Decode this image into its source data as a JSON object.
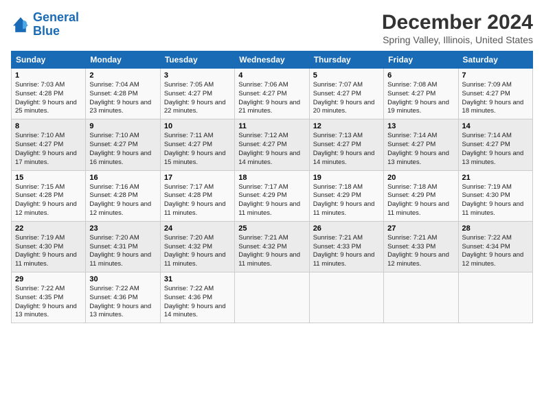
{
  "logo": {
    "line1": "General",
    "line2": "Blue"
  },
  "title": "December 2024",
  "subtitle": "Spring Valley, Illinois, United States",
  "days_header": [
    "Sunday",
    "Monday",
    "Tuesday",
    "Wednesday",
    "Thursday",
    "Friday",
    "Saturday"
  ],
  "weeks": [
    [
      {
        "day": 1,
        "sunrise": "7:03 AM",
        "sunset": "4:28 PM",
        "daylight": "9 hours and 25 minutes."
      },
      {
        "day": 2,
        "sunrise": "7:04 AM",
        "sunset": "4:28 PM",
        "daylight": "9 hours and 23 minutes."
      },
      {
        "day": 3,
        "sunrise": "7:05 AM",
        "sunset": "4:27 PM",
        "daylight": "9 hours and 22 minutes."
      },
      {
        "day": 4,
        "sunrise": "7:06 AM",
        "sunset": "4:27 PM",
        "daylight": "9 hours and 21 minutes."
      },
      {
        "day": 5,
        "sunrise": "7:07 AM",
        "sunset": "4:27 PM",
        "daylight": "9 hours and 20 minutes."
      },
      {
        "day": 6,
        "sunrise": "7:08 AM",
        "sunset": "4:27 PM",
        "daylight": "9 hours and 19 minutes."
      },
      {
        "day": 7,
        "sunrise": "7:09 AM",
        "sunset": "4:27 PM",
        "daylight": "9 hours and 18 minutes."
      }
    ],
    [
      {
        "day": 8,
        "sunrise": "7:10 AM",
        "sunset": "4:27 PM",
        "daylight": "9 hours and 17 minutes."
      },
      {
        "day": 9,
        "sunrise": "7:10 AM",
        "sunset": "4:27 PM",
        "daylight": "9 hours and 16 minutes."
      },
      {
        "day": 10,
        "sunrise": "7:11 AM",
        "sunset": "4:27 PM",
        "daylight": "9 hours and 15 minutes."
      },
      {
        "day": 11,
        "sunrise": "7:12 AM",
        "sunset": "4:27 PM",
        "daylight": "9 hours and 14 minutes."
      },
      {
        "day": 12,
        "sunrise": "7:13 AM",
        "sunset": "4:27 PM",
        "daylight": "9 hours and 14 minutes."
      },
      {
        "day": 13,
        "sunrise": "7:14 AM",
        "sunset": "4:27 PM",
        "daylight": "9 hours and 13 minutes."
      },
      {
        "day": 14,
        "sunrise": "7:14 AM",
        "sunset": "4:27 PM",
        "daylight": "9 hours and 13 minutes."
      }
    ],
    [
      {
        "day": 15,
        "sunrise": "7:15 AM",
        "sunset": "4:28 PM",
        "daylight": "9 hours and 12 minutes."
      },
      {
        "day": 16,
        "sunrise": "7:16 AM",
        "sunset": "4:28 PM",
        "daylight": "9 hours and 12 minutes."
      },
      {
        "day": 17,
        "sunrise": "7:17 AM",
        "sunset": "4:28 PM",
        "daylight": "9 hours and 11 minutes."
      },
      {
        "day": 18,
        "sunrise": "7:17 AM",
        "sunset": "4:29 PM",
        "daylight": "9 hours and 11 minutes."
      },
      {
        "day": 19,
        "sunrise": "7:18 AM",
        "sunset": "4:29 PM",
        "daylight": "9 hours and 11 minutes."
      },
      {
        "day": 20,
        "sunrise": "7:18 AM",
        "sunset": "4:29 PM",
        "daylight": "9 hours and 11 minutes."
      },
      {
        "day": 21,
        "sunrise": "7:19 AM",
        "sunset": "4:30 PM",
        "daylight": "9 hours and 11 minutes."
      }
    ],
    [
      {
        "day": 22,
        "sunrise": "7:19 AM",
        "sunset": "4:30 PM",
        "daylight": "9 hours and 11 minutes."
      },
      {
        "day": 23,
        "sunrise": "7:20 AM",
        "sunset": "4:31 PM",
        "daylight": "9 hours and 11 minutes."
      },
      {
        "day": 24,
        "sunrise": "7:20 AM",
        "sunset": "4:32 PM",
        "daylight": "9 hours and 11 minutes."
      },
      {
        "day": 25,
        "sunrise": "7:21 AM",
        "sunset": "4:32 PM",
        "daylight": "9 hours and 11 minutes."
      },
      {
        "day": 26,
        "sunrise": "7:21 AM",
        "sunset": "4:33 PM",
        "daylight": "9 hours and 11 minutes."
      },
      {
        "day": 27,
        "sunrise": "7:21 AM",
        "sunset": "4:33 PM",
        "daylight": "9 hours and 12 minutes."
      },
      {
        "day": 28,
        "sunrise": "7:22 AM",
        "sunset": "4:34 PM",
        "daylight": "9 hours and 12 minutes."
      }
    ],
    [
      {
        "day": 29,
        "sunrise": "7:22 AM",
        "sunset": "4:35 PM",
        "daylight": "9 hours and 13 minutes."
      },
      {
        "day": 30,
        "sunrise": "7:22 AM",
        "sunset": "4:36 PM",
        "daylight": "9 hours and 13 minutes."
      },
      {
        "day": 31,
        "sunrise": "7:22 AM",
        "sunset": "4:36 PM",
        "daylight": "9 hours and 14 minutes."
      },
      null,
      null,
      null,
      null
    ]
  ]
}
